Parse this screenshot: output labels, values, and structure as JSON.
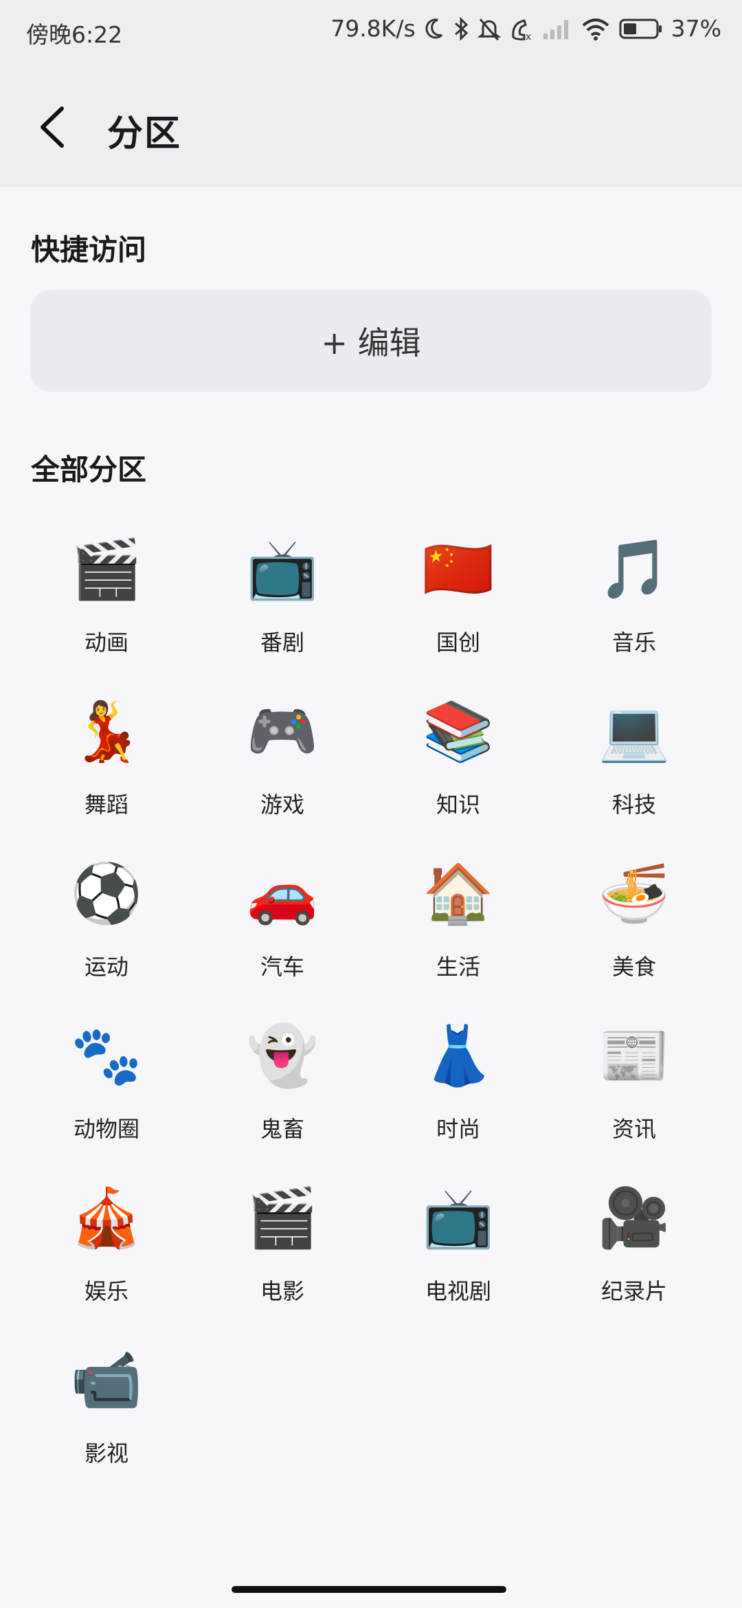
{
  "status_bar": {
    "time": "傍晚6:22",
    "net_speed": "79.8K/s",
    "battery": "37%"
  },
  "header": {
    "back_icon": "chevron-left-icon",
    "title": "分区"
  },
  "quick_access": {
    "title": "快捷访问",
    "edit_label": "+ 编辑"
  },
  "all_sections": {
    "title": "全部分区",
    "items": [
      {
        "label": "动画",
        "icon": "🎬"
      },
      {
        "label": "番剧",
        "icon": "📺"
      },
      {
        "label": "国创",
        "icon": "🇨🇳"
      },
      {
        "label": "音乐",
        "icon": "🎵"
      },
      {
        "label": "舞蹈",
        "icon": "💃"
      },
      {
        "label": "游戏",
        "icon": "🎮"
      },
      {
        "label": "知识",
        "icon": "📚"
      },
      {
        "label": "科技",
        "icon": "💻"
      },
      {
        "label": "运动",
        "icon": "⚽"
      },
      {
        "label": "汽车",
        "icon": "🚗"
      },
      {
        "label": "生活",
        "icon": "🏠"
      },
      {
        "label": "美食",
        "icon": "🍜"
      },
      {
        "label": "动物圈",
        "icon": "🐾"
      },
      {
        "label": "鬼畜",
        "icon": "👻"
      },
      {
        "label": "时尚",
        "icon": "👗"
      },
      {
        "label": "资讯",
        "icon": "📰"
      },
      {
        "label": "娱乐",
        "icon": "🎪"
      },
      {
        "label": "电影",
        "icon": "🎬"
      },
      {
        "label": "电视剧",
        "icon": "📺"
      },
      {
        "label": "纪录片",
        "icon": "🎥"
      },
      {
        "label": "影视",
        "icon": "📹"
      }
    ]
  }
}
